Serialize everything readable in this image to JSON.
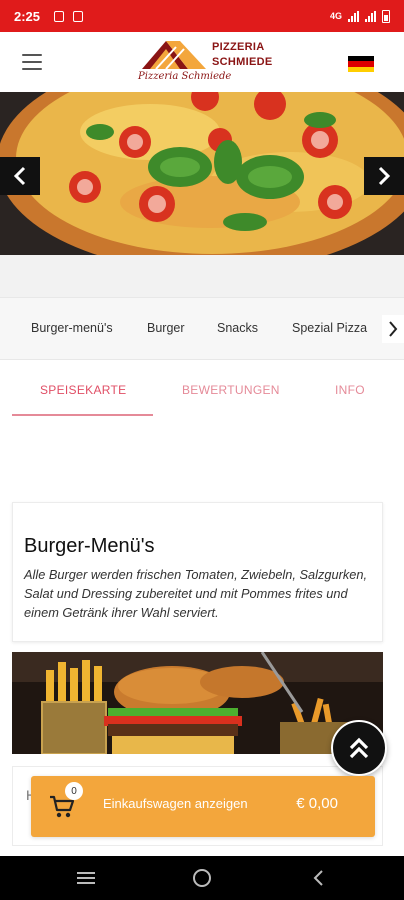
{
  "status_bar": {
    "time": "2:25",
    "network": "4G"
  },
  "header": {
    "logo_line_1": "PIZZERIA",
    "logo_line_2": "SCHMIEDE",
    "logo_script": "Pizzeria Schmiede",
    "language_flag": "german-flag-icon"
  },
  "hero": {
    "prev_icon": "chevron-left-icon",
    "next_icon": "chevron-right-icon"
  },
  "categories": [
    {
      "label": "Burger-menü's"
    },
    {
      "label": "Burger"
    },
    {
      "label": "Snacks"
    },
    {
      "label": "Spezial Pizza"
    }
  ],
  "tabs": [
    {
      "label": "SPEISEKARTE",
      "active": true
    },
    {
      "label": "BEWERTUNGEN",
      "active": false
    },
    {
      "label": "INFO",
      "active": false
    }
  ],
  "section": {
    "title": "Burger-Menü's",
    "description": "Alle Burger werden frischen Tomaten, Zwiebeln, Salzgurken, Salat und Dressing zubereitet und mit Pommes frites und einem Getränk ihrer Wahl serviert."
  },
  "item": {
    "partial_text": "H"
  },
  "cart": {
    "count": "0",
    "label": "Einkaufswagen anzeigen",
    "total": "€ 0,00"
  },
  "colors": {
    "status_bar": "#e01b1b",
    "accent": "#e04e65",
    "cart": "#f3a63c"
  }
}
